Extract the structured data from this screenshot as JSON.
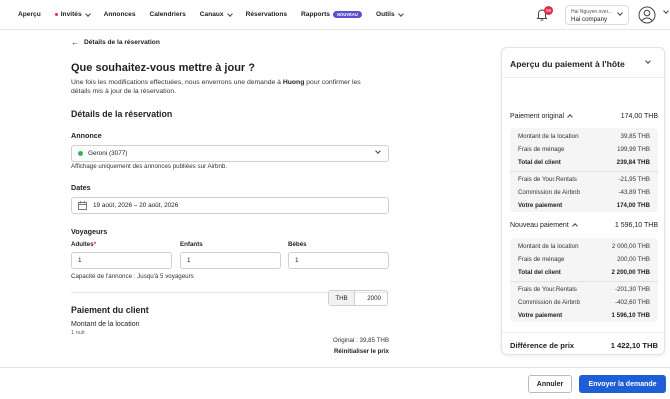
{
  "nav": {
    "items": [
      {
        "label": "Aperçu",
        "dot": false,
        "chevron": false
      },
      {
        "label": "Invités",
        "dot": true,
        "chevron": true
      },
      {
        "label": "Annonces",
        "dot": false,
        "chevron": false
      },
      {
        "label": "Calendriers",
        "dot": false,
        "chevron": false
      },
      {
        "label": "Canaux",
        "dot": false,
        "chevron": true
      },
      {
        "label": "Réservations",
        "dot": false,
        "chevron": false
      },
      {
        "label": "Rapports",
        "dot": false,
        "chevron": false,
        "badge": "NOUVEAU"
      },
      {
        "label": "Outils",
        "dot": false,
        "chevron": true
      }
    ],
    "notifications_count": "99",
    "account_user": "Hai Nguyen over...",
    "account_company": "Hai company"
  },
  "page": {
    "back_label": "Détails de la réservation",
    "title": "Que souhaitez-vous mettre à jour ?",
    "intro_before": "Une fois les modifications effectuées, nous enverrons une demande à ",
    "intro_host": "Huong",
    "intro_after": " pour confirmer les détails mis à jour de la réservation.",
    "details_heading": "Détails de la réservation",
    "listing_label": "Annonce",
    "listing_value": "Geroni (3077)",
    "listing_note": "Affichage uniquement des annonces publiées sur Airbnb.",
    "dates_label": "Dates",
    "dates_value": "19 août, 2026 – 20 août, 2026",
    "guests_label": "Voyageurs",
    "adults_label": "Adultes",
    "adults_required": "*",
    "adults_value": "1",
    "children_label": "Enfants",
    "children_value": "1",
    "babies_label": "Bébés",
    "babies_value": "1",
    "capacity_note": "Capacité de l'annonce : Jusqu'à 5 voyageurs",
    "client_payment_heading": "Paiement du client",
    "rental_amount_label": "Montant de la location",
    "nights_label": "1 nuit",
    "currency": "THB",
    "rental_amount_value": "2000",
    "original_note": "Original : 39,85 THB",
    "reset_label": "Réinitialiser le prix"
  },
  "panel": {
    "title": "Aperçu du paiement à l'hôte",
    "original": {
      "label": "Paiement original",
      "total": "174,00 THB",
      "rows_client": [
        {
          "label": "Montant de la location",
          "value": "39,85 THB"
        },
        {
          "label": "Frais de ménage",
          "value": "199,99 THB"
        }
      ],
      "total_client_label": "Total del client",
      "total_client_value": "239,84 THB",
      "rows_fees": [
        {
          "label": "Frais de Your.Rentals",
          "value": "-21,95 THB"
        },
        {
          "label": "Commission de Airbnb",
          "value": "-43,89 THB"
        }
      ],
      "your_payment_label": "Votre paiement",
      "your_payment_value": "174,00 THB"
    },
    "new": {
      "label": "Nouveau paiement",
      "total": "1 596,10 THB",
      "rows_client": [
        {
          "label": "Montant de la location",
          "value": "2 000,00 THB"
        },
        {
          "label": "Frais de ménage",
          "value": "200,00 THB"
        }
      ],
      "total_client_label": "Total del client",
      "total_client_value": "2 200,00 THB",
      "rows_fees": [
        {
          "label": "Frais de Your.Rentals",
          "value": "-201,30 THB"
        },
        {
          "label": "Commission de Airbnb",
          "value": "-402,60 THB"
        }
      ],
      "your_payment_label": "Votre paiement",
      "your_payment_value": "1 596,10 THB"
    },
    "difference_label": "Différence de prix",
    "difference_value": "1 422,10 THB"
  },
  "footer": {
    "cancel_label": "Annuler",
    "send_label": "Envoyer la demande"
  },
  "colors": {
    "accent": "#1f5fd6",
    "badge": "#5a4fcf",
    "alert": "#e02b4a",
    "status_published": "#2fb45a"
  }
}
